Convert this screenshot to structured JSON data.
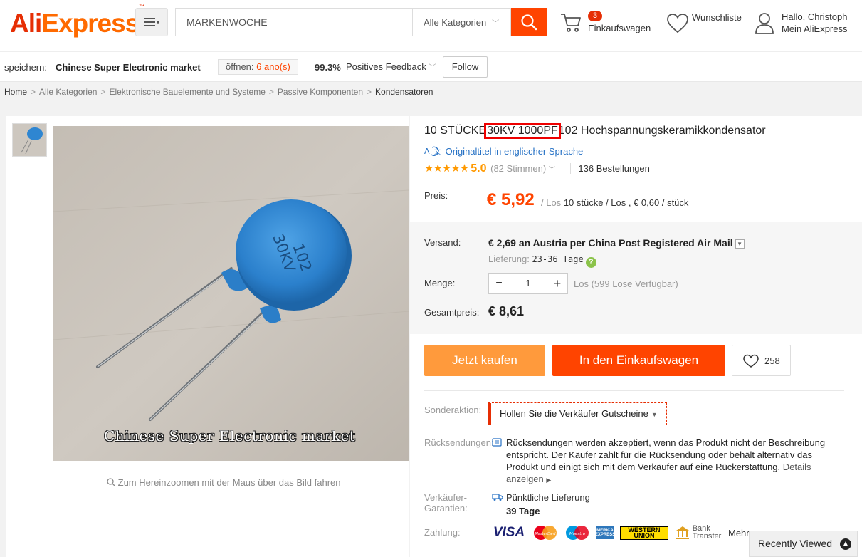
{
  "header": {
    "logo_ali": "Ali",
    "logo_express": "Express",
    "logo_tm": "™",
    "search_value": "MARKENWOCHE",
    "category": "Alle Kategorien",
    "cart_count": "3",
    "cart_label": "Einkaufswagen",
    "wishlist_label": "Wunschliste",
    "account_greeting": "Hallo, Christoph",
    "account_label": "Mein AliExpress"
  },
  "store": {
    "save_label": "speichern:",
    "name": "Chinese Super Electronic market",
    "open_label": "öffnen:",
    "open_value": "6 ano(s)",
    "feedback_pct": "99.3%",
    "feedback_label": "Positives Feedback",
    "follow": "Follow"
  },
  "breadcrumb": [
    "Home",
    "Alle Kategorien",
    "Elektronische Bauelemente und Systeme",
    "Passive Komponenten",
    "Kondensatoren"
  ],
  "gallery": {
    "watermark": "Chinese Super Electronic market",
    "zoom_hint": "Zum Hereinzoomen mit der Maus über das Bild fahren",
    "capacitor_text_1": "102",
    "capacitor_text_2": "30KV"
  },
  "product": {
    "title_before": "10 STÜCKE",
    "title_highlight": "30KV 1000PF",
    "title_after": "102 Hochspannungskeramikkondensator",
    "original_title_link": "Originaltitel in englischer Sprache",
    "stars": "★★★★★",
    "rating": "5.0",
    "votes": "(82 Stimmen)",
    "orders": "136 Bestellungen",
    "price_label": "Preis:",
    "price": "€ 5,92",
    "price_per": "/ Los",
    "price_detail": "10 stücke / Los , € 0,60 / stück",
    "shipping_label": "Versand:",
    "shipping_value": "€ 2,69 an Austria per China Post Registered Air Mail",
    "delivery_label": "Lieferung:",
    "delivery_value": "23-36 Tage",
    "qty_label": "Menge:",
    "qty_value": "1",
    "qty_minus": "−",
    "qty_plus": "+",
    "qty_available": "Los (599 Lose Verfügbar)",
    "total_label": "Gesamtpreis:",
    "total_value": "€ 8,61",
    "buy_now": "Jetzt kaufen",
    "add_to_cart": "In den Einkaufswagen",
    "wish_count": "258",
    "promo_label": "Sonderaktion:",
    "promo_value": "Hollen Sie die Verkäufer Gutscheine",
    "returns_label": "Rücksendungen:",
    "returns_text": "Rücksendungen werden akzeptiert, wenn das Produkt nicht der Beschreibung entspricht. Der Käufer zahlt für die Rücksendung oder behält alternativ das Produkt und einigt sich mit dem Verkäufer auf eine Rückerstattung.",
    "returns_more": "Details anzeigen",
    "guarantee_label_1": "Verkäufer-",
    "guarantee_label_2": "Garantien:",
    "guarantee_value": "Pünktliche Lieferung",
    "guarantee_days": "39 Tage",
    "payment_label": "Zahlung:",
    "payment_visa": "VISA",
    "payment_mastercard": "MasterCard",
    "payment_maestro": "Maestro",
    "payment_amex": "AMERICAN EXPRESS",
    "payment_wu_1": "WESTERN",
    "payment_wu_2": "UNION",
    "payment_bank_1": "Bank",
    "payment_bank_2": "Transfer",
    "payment_more": "Mehr"
  },
  "recently_viewed": "Recently Viewed",
  "colors": {
    "brand_red": "#e62e04",
    "brand_orange": "#ff6a00",
    "price_orange": "#ff4400",
    "buy_orange": "#ff9a3c",
    "link_blue": "#2772c5",
    "highlight_red": "#ee0000"
  }
}
